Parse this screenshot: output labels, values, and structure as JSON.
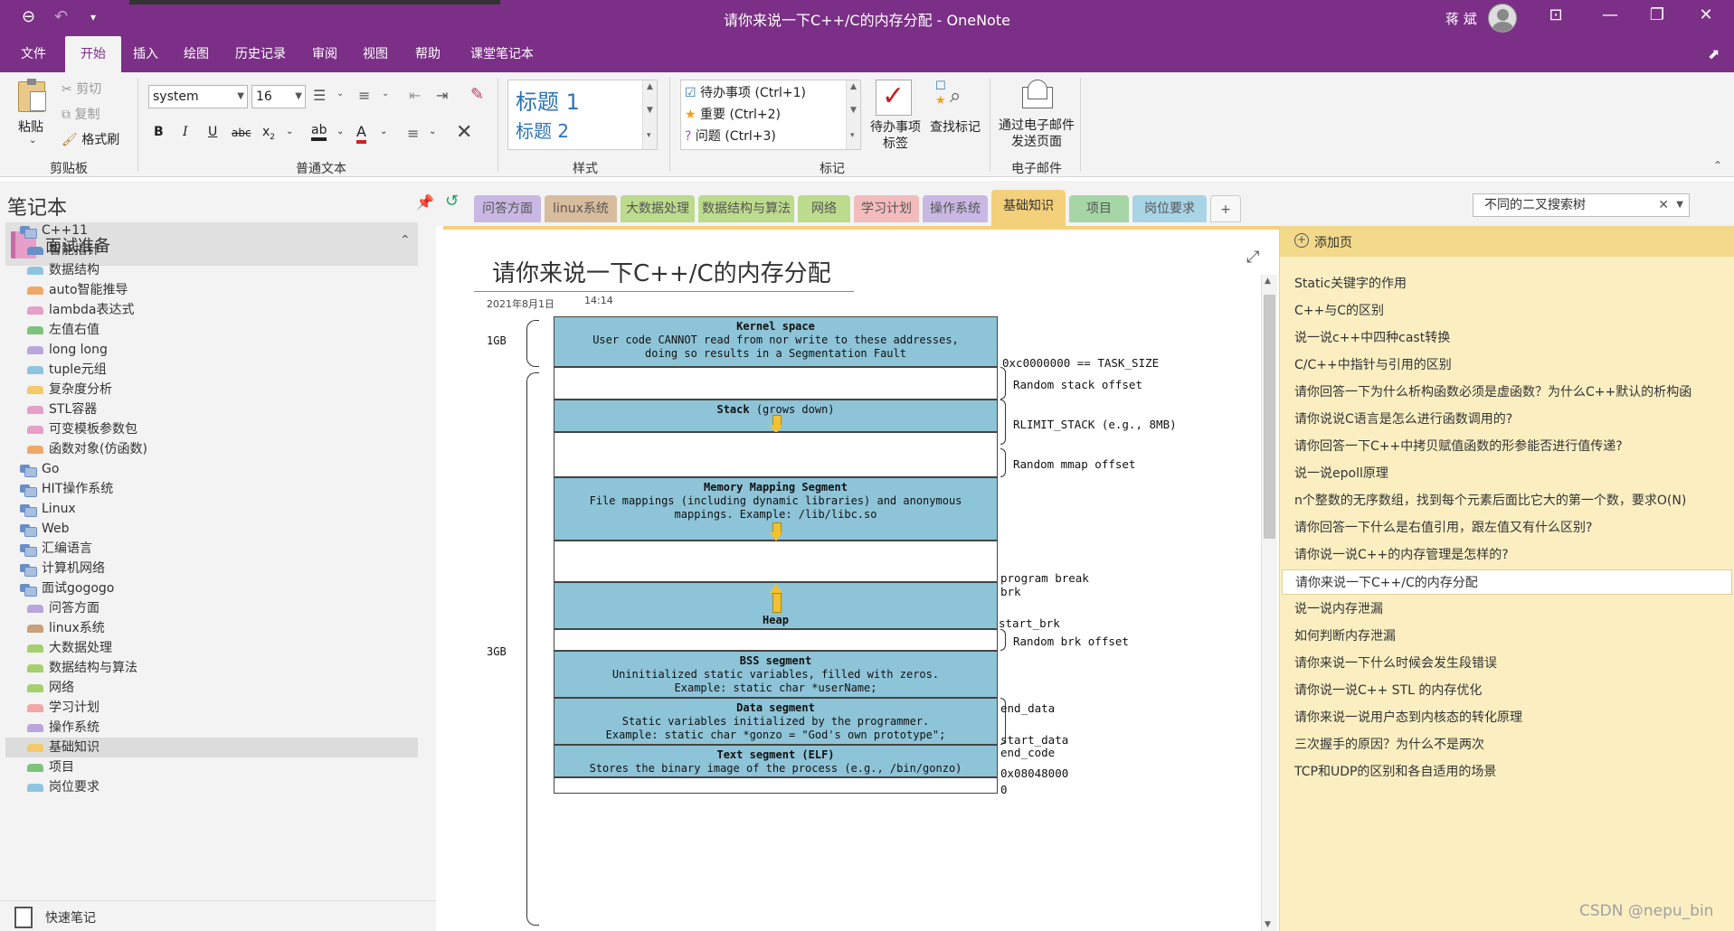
{
  "app": {
    "window_title": "请你来说一下C++/C的内存分配 - OneNote",
    "user": "蒋 斌"
  },
  "menu": {
    "tabs": [
      "文件",
      "开始",
      "插入",
      "绘图",
      "历史记录",
      "审阅",
      "视图",
      "帮助",
      "课堂笔记本"
    ],
    "active": "开始"
  },
  "ribbon": {
    "clipboard": {
      "paste": "粘贴",
      "cut": "剪切",
      "copy": "复制",
      "format_painter": "格式刷",
      "label": "剪贴板"
    },
    "text": {
      "font": "system",
      "size": "16",
      "label": "普通文本"
    },
    "styles": {
      "h1": "标题 1",
      "h2": "标题 2",
      "label": "样式"
    },
    "tags": {
      "items": [
        "待办事项 (Ctrl+1)",
        "重要 (Ctrl+2)",
        "问题 (Ctrl+3)"
      ],
      "todo_tag": "待办事项标签",
      "find_tags": "查找标记",
      "label": "标记"
    },
    "email": {
      "send": "通过电子邮件发送页面",
      "label": "电子邮件"
    }
  },
  "notebook": {
    "header": "笔记本",
    "name": "面试准备",
    "tree": [
      {
        "type": "group",
        "label": "C++11",
        "indent": 0
      },
      {
        "type": "section",
        "label": "智能指针",
        "color": "#6a8fc8",
        "indent": 1
      },
      {
        "type": "section",
        "label": "数据结构",
        "color": "#8ec4e0",
        "indent": 1
      },
      {
        "type": "section",
        "label": "auto智能推导",
        "color": "#f0a868",
        "indent": 1
      },
      {
        "type": "section",
        "label": "lambda表达式",
        "color": "#e59fc9",
        "indent": 1
      },
      {
        "type": "section",
        "label": "左值右值",
        "color": "#7cc47c",
        "indent": 1
      },
      {
        "type": "section",
        "label": "long long",
        "color": "#b9a6dc",
        "indent": 1
      },
      {
        "type": "section",
        "label": "tuple元组",
        "color": "#8ec4e0",
        "indent": 1
      },
      {
        "type": "section",
        "label": "复杂度分析",
        "color": "#f3c96a",
        "indent": 1
      },
      {
        "type": "section",
        "label": "STL容器",
        "color": "#e59fc9",
        "indent": 1
      },
      {
        "type": "section",
        "label": "可变模板参数包",
        "color": "#e59fc9",
        "indent": 1
      },
      {
        "type": "section",
        "label": "函数对象(仿函数)",
        "color": "#f0a868",
        "indent": 1
      },
      {
        "type": "group",
        "label": "Go",
        "indent": 0
      },
      {
        "type": "group",
        "label": "HIT操作系统",
        "indent": 0
      },
      {
        "type": "group",
        "label": "Linux",
        "indent": 0
      },
      {
        "type": "group",
        "label": "Web",
        "indent": 0
      },
      {
        "type": "group",
        "label": "汇编语言",
        "indent": 0
      },
      {
        "type": "group",
        "label": "计算机网络",
        "indent": 0
      },
      {
        "type": "group",
        "label": "面试gogogo",
        "indent": 0
      },
      {
        "type": "section",
        "label": "问答方面",
        "color": "#b9a6dc",
        "indent": 1
      },
      {
        "type": "section",
        "label": "linux系统",
        "color": "#c9a07a",
        "indent": 1
      },
      {
        "type": "section",
        "label": "大数据处理",
        "color": "#a6d06e",
        "indent": 1
      },
      {
        "type": "section",
        "label": "数据结构与算法",
        "color": "#a6d06e",
        "indent": 1
      },
      {
        "type": "section",
        "label": "网络",
        "color": "#a6d06e",
        "indent": 1
      },
      {
        "type": "section",
        "label": "学习计划",
        "color": "#f3a6a6",
        "indent": 1
      },
      {
        "type": "section",
        "label": "操作系统",
        "color": "#b9a6dc",
        "indent": 1
      },
      {
        "type": "section",
        "label": "基础知识",
        "color": "#f3c96a",
        "indent": 1,
        "selected": true
      },
      {
        "type": "section",
        "label": "项目",
        "color": "#7cc47c",
        "indent": 1
      },
      {
        "type": "section",
        "label": "岗位要求",
        "color": "#8ec4e0",
        "indent": 1
      }
    ],
    "quick_notes": "快速笔记"
  },
  "section_tabs": [
    {
      "label": "问答方面",
      "color": "#c9b8e4"
    },
    {
      "label": "linux系统",
      "color": "#d8bc9e"
    },
    {
      "label": "大数据处理",
      "color": "#bcdb8c"
    },
    {
      "label": "数据结构与算法",
      "color": "#bcdb8c"
    },
    {
      "label": "网络",
      "color": "#bcdb8c"
    },
    {
      "label": "学习计划",
      "color": "#f3bcbc"
    },
    {
      "label": "操作系统",
      "color": "#c9b8e4"
    },
    {
      "label": "基础知识",
      "color": "#f4d07a",
      "active": true
    },
    {
      "label": "项目",
      "color": "#a6d6a6"
    },
    {
      "label": "岗位要求",
      "color": "#a8d4e6"
    },
    {
      "label": "+",
      "color": "#f8f8f8"
    }
  ],
  "search": {
    "value": "不同的二叉搜索树"
  },
  "page": {
    "title": "请你来说一下C++/C的内存分配",
    "date": "2021年8月1日",
    "time": "14:14"
  },
  "diagram": {
    "gb1": "1GB",
    "gb3": "3GB",
    "kernel_title": "Kernel space",
    "kernel_l1": "User code CANNOT read from nor write to these addresses,",
    "kernel_l2": "doing so results in a Segmentation Fault",
    "stack_title": "Stack",
    "stack_note": "(grows down)",
    "mmap_title": "Memory Mapping Segment",
    "mmap_l1": "File mappings (including dynamic libraries) and anonymous",
    "mmap_l2": "mappings. Example: /lib/libc.so",
    "heap_title": "Heap",
    "bss_title": "BSS segment",
    "bss_l1": "Uninitialized static variables, filled with zeros.",
    "bss_l2": "Example: static char *userName;",
    "data_title": "Data segment",
    "data_l1": "Static variables initialized by the programmer.",
    "data_l2": "Example: static char *gonzo = \"God's own prototype\";",
    "text_title": "Text segment (ELF)",
    "text_l1": "Stores the binary image of the process (e.g., /bin/gonzo)",
    "r_task": "0xc0000000 == TASK_SIZE",
    "r_rand_stack": "Random stack offset",
    "r_rlimit": "RLIMIT_STACK (e.g., 8MB)",
    "r_rand_mmap": "Random mmap offset",
    "r_pbreak": "program break",
    "r_brk": "brk",
    "r_start_brk": "start_brk",
    "r_rand_brk": "Random brk offset",
    "r_end_data": "end_data",
    "r_start_data": "start_data",
    "r_end_code": "end_code",
    "r_addr": "0x08048000",
    "r_zero": "0"
  },
  "pages": {
    "add_page": "添加页",
    "items": [
      "Static关键字的作用",
      "C++与C的区别",
      "说一说c++中四种cast转换",
      "C/C++中指针与引用的区别",
      "请你回答一下为什么析构函数必须是虚函数？为什么C++默认的析构函",
      "请你说说C语言是怎么进行函数调用的?",
      "请你回答一下C++中拷贝赋值函数的形参能否进行值传递?",
      "说一说epoll原理",
      "n个整数的无序数组，找到每个元素后面比它大的第一个数，要求O(N)",
      "请你回答一下什么是右值引用，跟左值又有什么区别?",
      "请你说一说C++的内存管理是怎样的?",
      "请你来说一下C++/C的内存分配",
      "说一说内存泄漏",
      "如何判断内存泄漏",
      "请你来说一下什么时候会发生段错误",
      "请你说一说C++ STL 的内存优化",
      "请你来说一说用户态到内核态的转化原理",
      "三次握手的原因？为什么不是两次",
      "TCP和UDP的区别和各自适用的场景"
    ],
    "selected_index": 11
  },
  "watermark": "CSDN @nepu_bin"
}
